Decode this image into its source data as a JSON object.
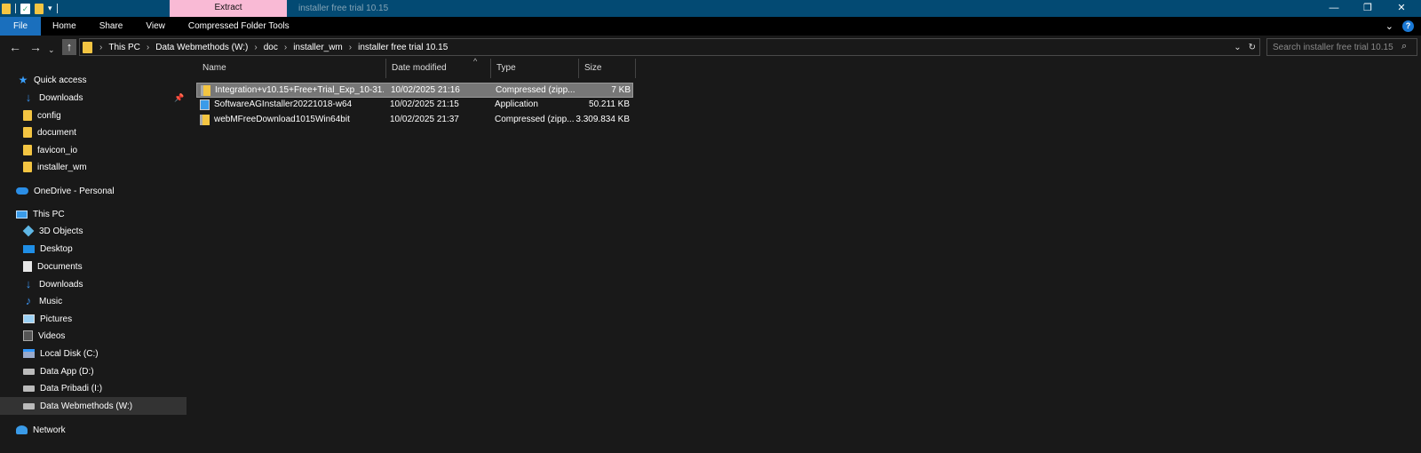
{
  "titlebar": {
    "context_tab": "Extract",
    "window_title": "installer free trial 10.15",
    "controls": {
      "minimize": "—",
      "maximize": "❐",
      "close": "✕"
    }
  },
  "ribbon": {
    "tabs": [
      {
        "label": "File"
      },
      {
        "label": "Home"
      },
      {
        "label": "Share"
      },
      {
        "label": "View"
      },
      {
        "label": "Compressed Folder Tools"
      }
    ]
  },
  "address": {
    "crumbs": [
      "This PC",
      "Data Webmethods (W:)",
      "doc",
      "installer_wm",
      "installer free trial 10.15"
    ],
    "search_placeholder": "Search installer free trial 10.15"
  },
  "nav": {
    "quick_access": "Quick access",
    "quick_items": [
      "Downloads",
      "config",
      "document",
      "favicon_io",
      "installer_wm"
    ],
    "onedrive": "OneDrive - Personal",
    "this_pc": "This PC",
    "pc_items": [
      "3D Objects",
      "Desktop",
      "Documents",
      "Downloads",
      "Music",
      "Pictures",
      "Videos",
      "Local Disk (C:)",
      "Data App (D:)",
      "Data Pribadi (I:)",
      "Data Webmethods (W:)"
    ],
    "network": "Network"
  },
  "files": {
    "columns": [
      "Name",
      "Date modified",
      "Type",
      "Size"
    ],
    "rows": [
      {
        "name": "Integration+v10.15+Free+Trial_Exp_10-31...",
        "date": "10/02/2025 21:16",
        "type": "Compressed (zipp...",
        "size": "7 KB"
      },
      {
        "name": "SoftwareAGInstaller20221018-w64",
        "date": "10/02/2025 21:15",
        "type": "Application",
        "size": "50.211 KB"
      },
      {
        "name": "webMFreeDownload1015Win64bit",
        "date": "10/02/2025 21:37",
        "type": "Compressed (zipp...",
        "size": "3.309.834 KB"
      }
    ]
  },
  "icons": {
    "file_0": "zip-folder-icon",
    "file_1": "application-icon",
    "file_2": "zip-folder-icon"
  },
  "colors": {
    "titlebar": "#034a73",
    "extract_tab": "#f9bad5",
    "file_tab": "#1a6fbd",
    "background": "#191919",
    "selection": "#777777"
  }
}
